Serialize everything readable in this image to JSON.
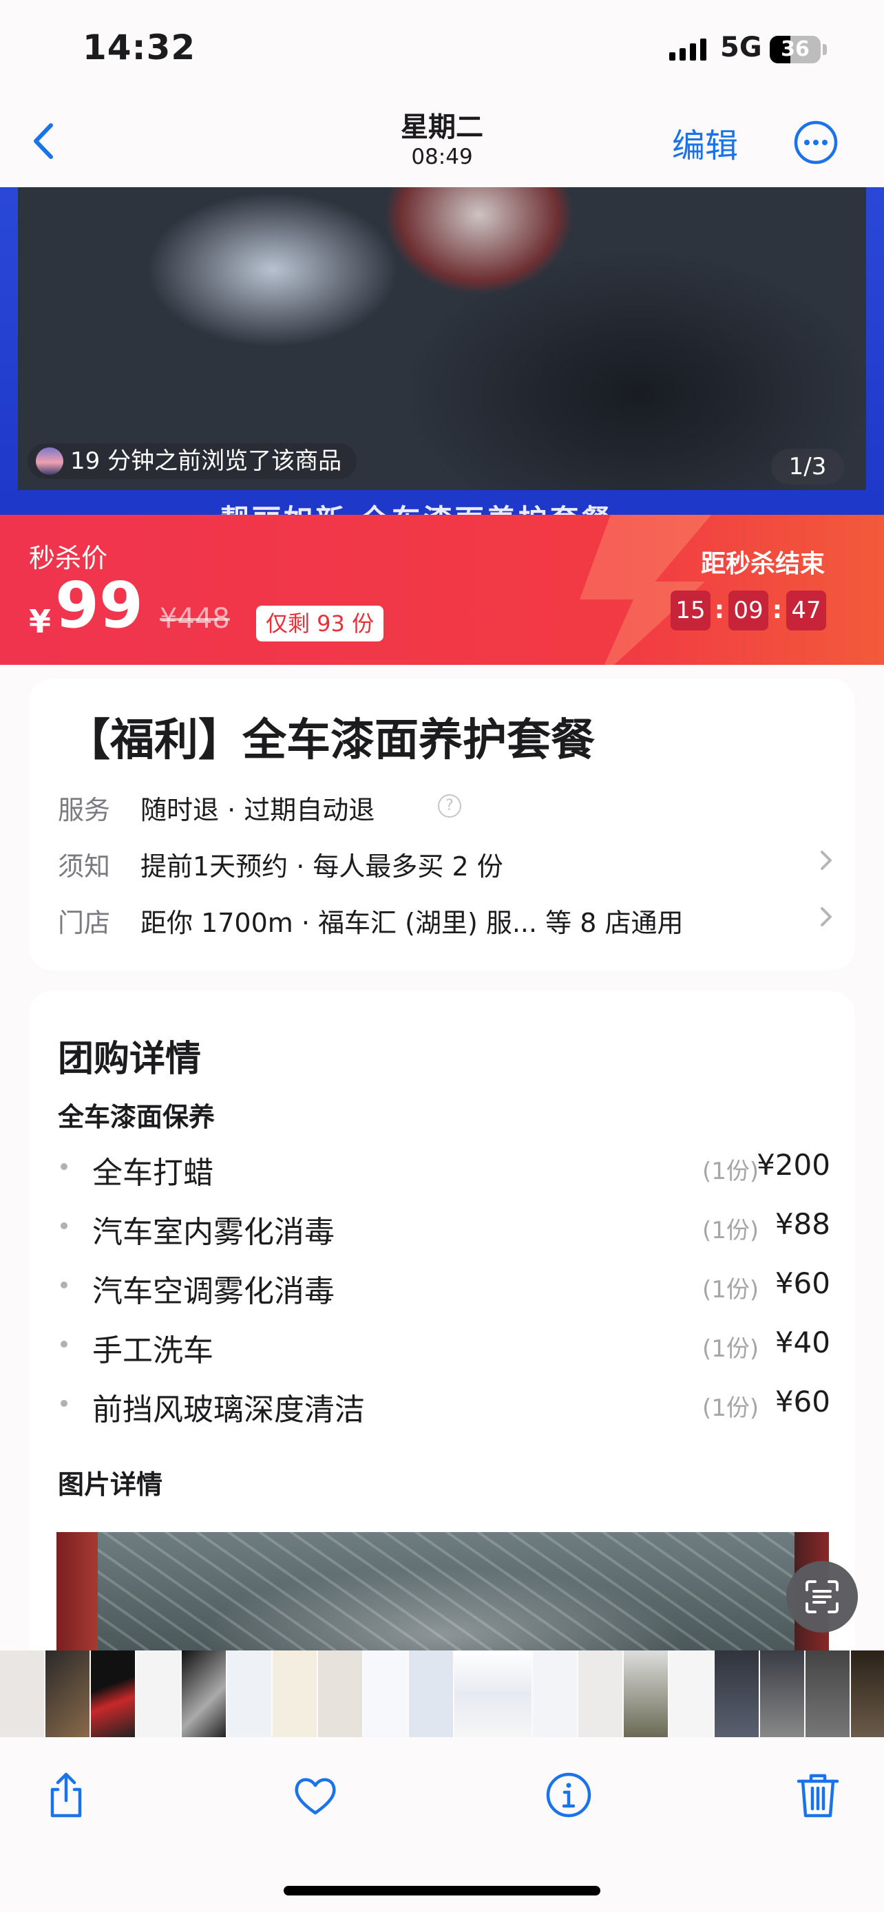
{
  "status_bar": {
    "time": "14:32",
    "network": "5G",
    "battery": "36"
  },
  "nav": {
    "title": "星期二",
    "subtitle": "08:49",
    "edit_label": "编辑"
  },
  "hero": {
    "band_text": "靓丽如新  全车漆面养护套餐",
    "viewed_text": "19 分钟之前浏览了该商品",
    "page_counter": "1/3"
  },
  "flash_sale": {
    "label": "秒杀价",
    "currency": "¥",
    "price": "99",
    "original_price": "¥448",
    "remaining": "仅剩 93 份",
    "countdown_label": "距秒杀结束",
    "countdown": {
      "hours": "15",
      "minutes": "09",
      "seconds": "47",
      "sep": ":"
    },
    "colors": {
      "background": "#f0344e",
      "box": "#c7243a"
    }
  },
  "product": {
    "title": "【福利】全车漆面养护套餐",
    "rows": [
      {
        "key": "服务",
        "value": "随时退 · 过期自动退"
      },
      {
        "key": "须知",
        "value": "提前1天预约 · 每人最多买 2 份"
      },
      {
        "key": "门店",
        "value": "距你 1700m · 福车汇 (湖里) 服... 等 8 店通用"
      }
    ],
    "help_glyph": "?"
  },
  "details": {
    "title": "团购详情",
    "section": "全车漆面保养",
    "items": [
      {
        "name": "全车打蜡",
        "qty": "(1份)",
        "price": "¥200"
      },
      {
        "name": "汽车室内雾化消毒",
        "qty": "(1份)",
        "price": "¥88"
      },
      {
        "name": "汽车空调雾化消毒",
        "qty": "(1份)",
        "price": "¥60"
      },
      {
        "name": "手工洗车",
        "qty": "(1份)",
        "price": "¥40"
      },
      {
        "name": "前挡风玻璃深度清洁",
        "qty": "(1份)",
        "price": "¥60"
      }
    ],
    "picture_title": "图片详情"
  },
  "icons": {
    "back": "chevron-left-icon",
    "more": "ellipsis-circle-icon",
    "chevron": "chevron-right-icon",
    "help": "question-circle-icon",
    "scan": "live-text-scan-icon",
    "share": "share-icon",
    "favorite": "heart-icon",
    "info": "info-icon",
    "delete": "trash-icon"
  },
  "accent_color": "#1a73e8"
}
